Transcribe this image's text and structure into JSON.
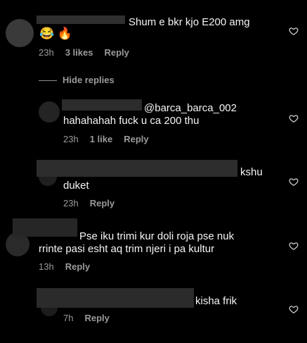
{
  "comments": [
    {
      "text": "Shum e bkr kjo E200 amg",
      "emoji": "😂 🔥",
      "time": "23h",
      "likes": "3 likes",
      "reply": "Reply"
    },
    {
      "mention": "@barca_barca_002",
      "text": "hahahahah fuck u ca 200 thu",
      "time": "23h",
      "likes": "1 like",
      "reply": "Reply"
    },
    {
      "line1": "kshu",
      "line2": "duket",
      "time": "23h",
      "reply": "Reply"
    },
    {
      "line1": "Pse iku trimi kur doli roja pse nuk",
      "line2": "rrinte pasi esht aq trim njeri i pa kultur",
      "time": "13h",
      "reply": "Reply"
    },
    {
      "text": "kisha frik",
      "time": "7h",
      "reply": "Reply"
    }
  ],
  "hide_replies": "Hide replies",
  "icons": {
    "like": "heart-icon"
  }
}
